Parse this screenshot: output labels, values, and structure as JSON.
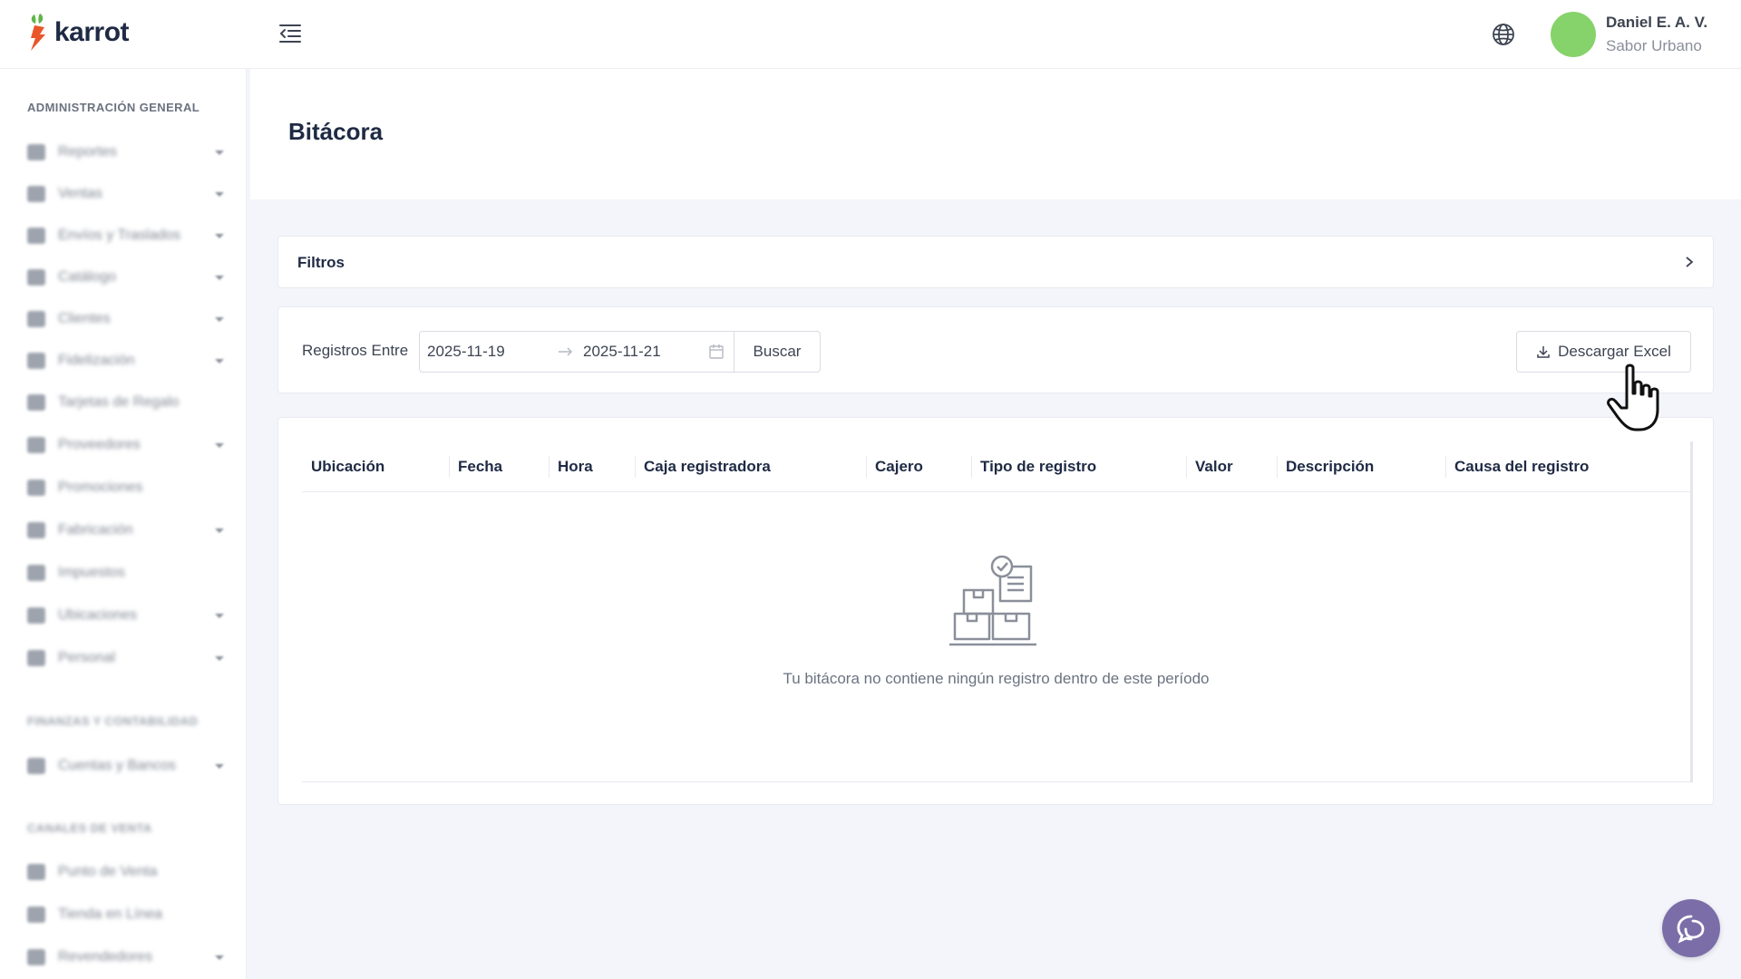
{
  "brand": {
    "name": "karrot"
  },
  "user": {
    "name": "Daniel E. A. V.",
    "company": "Sabor Urbano",
    "avatar_color": "#86d36b"
  },
  "sidebar": {
    "section_admin": "ADMINISTRACIÓN GENERAL",
    "section_finance": "FINANZAS Y CONTABILIDAD",
    "section_channels": "CANALES DE VENTA",
    "items": [
      {
        "label": "Reportes",
        "icon": "chart-icon"
      },
      {
        "label": "Ventas",
        "icon": "bag-icon"
      },
      {
        "label": "Envíos y Traslados",
        "icon": "truck-icon"
      },
      {
        "label": "Catálogo",
        "icon": "tag-icon"
      },
      {
        "label": "Clientes",
        "icon": "users-icon"
      },
      {
        "label": "Fidelización",
        "icon": "heart-icon"
      },
      {
        "label": "Tarjetas de Regalo",
        "icon": "gift-icon"
      },
      {
        "label": "Proveedores",
        "icon": "building-icon"
      },
      {
        "label": "Promociones",
        "icon": "promo-icon"
      },
      {
        "label": "Fabricación",
        "icon": "hammer-icon"
      },
      {
        "label": "Impuestos",
        "icon": "percent-icon"
      },
      {
        "label": "Ubicaciones",
        "icon": "store-icon"
      },
      {
        "label": "Personal",
        "icon": "id-card-icon"
      },
      {
        "label": "Cuentas y Bancos",
        "icon": "dollar-icon"
      },
      {
        "label": "Punto de Venta",
        "icon": "pos-icon"
      },
      {
        "label": "Tienda en Línea",
        "icon": "monitor-icon"
      },
      {
        "label": "Revendedores",
        "icon": "network-icon"
      }
    ]
  },
  "page": {
    "title": "Bitácora"
  },
  "filters": {
    "label": "Filtros"
  },
  "search": {
    "range_label": "Registros Entre",
    "start_date": "2025-11-19",
    "end_date": "2025-11-21",
    "search_button": "Buscar",
    "excel_button": "Descargar Excel"
  },
  "table": {
    "columns": [
      "Ubicación",
      "Fecha",
      "Hora",
      "Caja registradora",
      "Cajero",
      "Tipo de registro",
      "Valor",
      "Descripción",
      "Causa del registro"
    ],
    "empty_message": "Tu bitácora no contiene ningún registro dentro de este período"
  },
  "colors": {
    "accent": "#7b6ea8",
    "brand_orange": "#e8562a",
    "brand_green": "#5fb548"
  }
}
